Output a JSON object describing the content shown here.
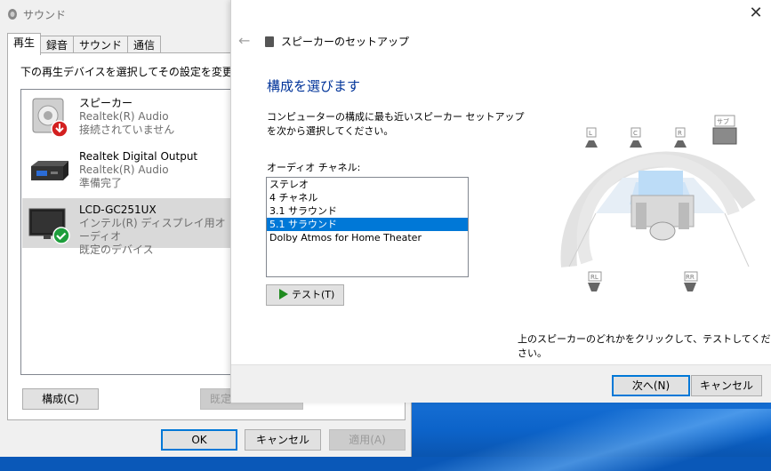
{
  "sound_window": {
    "title": "サウンド",
    "tabs": [
      "再生",
      "録音",
      "サウンド",
      "通信"
    ],
    "instruction": "下の再生デバイスを選択してその設定を変更してください:",
    "devices": [
      {
        "name": "スピーカー",
        "driver": "Realtek(R) Audio",
        "status": "接続されていません"
      },
      {
        "name": "Realtek Digital Output",
        "driver": "Realtek(R) Audio",
        "status": "準備完了"
      },
      {
        "name": "LCD-GC251UX",
        "driver": "インテル(R) ディスプレイ用オーディオ",
        "status": "既定のデバイス"
      }
    ],
    "configure_label": "構成(C)",
    "default_label": "既定",
    "ok_label": "OK",
    "cancel_label": "キャンセル",
    "apply_label": "適用(A)"
  },
  "setup_window": {
    "close_glyph": "✕",
    "back_glyph": "←",
    "wizard_title": "スピーカーのセットアップ",
    "heading": "構成を選びます",
    "description": "コンピューターの構成に最も近いスピーカー セットアップを次から選択してください。",
    "channels_label": "オーディオ チャネル:",
    "channels": [
      "ステレオ",
      "4 チャネル",
      "3.1 サラウンド",
      "5.1 サラウンド",
      "Dolby Atmos for Home Theater"
    ],
    "selected_channel": "5.1 サラウンド",
    "test_label": "テスト(T)",
    "hint": "上のスピーカーのどれかをクリックして、テストしてください。",
    "next_label": "次へ(N)",
    "cancel_label": "キャンセル",
    "speaker_labels": {
      "left": "L",
      "center": "C",
      "right": "R",
      "sub": "サブ",
      "rear_left": "RL",
      "rear_right": "RR"
    }
  },
  "colors": {
    "accent": "#0078d7",
    "heading": "#003399",
    "check": "#1e9e3c",
    "error": "#d32020"
  }
}
